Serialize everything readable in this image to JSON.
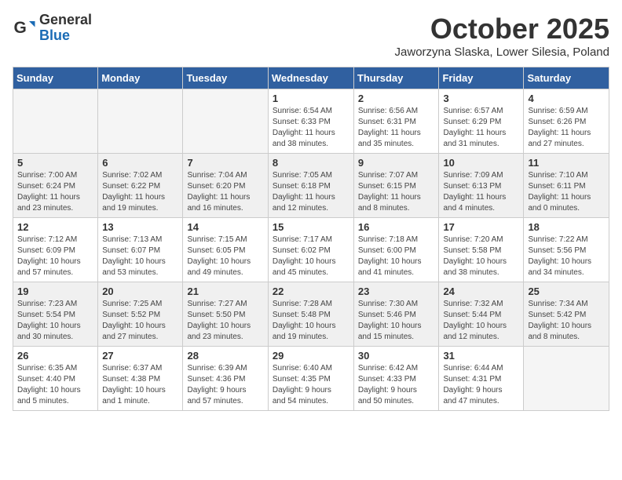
{
  "header": {
    "logo": {
      "general": "General",
      "blue": "Blue"
    },
    "title": "October 2025",
    "subtitle": "Jaworzyna Slaska, Lower Silesia, Poland"
  },
  "weekdays": [
    "Sunday",
    "Monday",
    "Tuesday",
    "Wednesday",
    "Thursday",
    "Friday",
    "Saturday"
  ],
  "weeks": [
    [
      {
        "day": "",
        "info": ""
      },
      {
        "day": "",
        "info": ""
      },
      {
        "day": "",
        "info": ""
      },
      {
        "day": "1",
        "info": "Sunrise: 6:54 AM\nSunset: 6:33 PM\nDaylight: 11 hours\nand 38 minutes."
      },
      {
        "day": "2",
        "info": "Sunrise: 6:56 AM\nSunset: 6:31 PM\nDaylight: 11 hours\nand 35 minutes."
      },
      {
        "day": "3",
        "info": "Sunrise: 6:57 AM\nSunset: 6:29 PM\nDaylight: 11 hours\nand 31 minutes."
      },
      {
        "day": "4",
        "info": "Sunrise: 6:59 AM\nSunset: 6:26 PM\nDaylight: 11 hours\nand 27 minutes."
      }
    ],
    [
      {
        "day": "5",
        "info": "Sunrise: 7:00 AM\nSunset: 6:24 PM\nDaylight: 11 hours\nand 23 minutes."
      },
      {
        "day": "6",
        "info": "Sunrise: 7:02 AM\nSunset: 6:22 PM\nDaylight: 11 hours\nand 19 minutes."
      },
      {
        "day": "7",
        "info": "Sunrise: 7:04 AM\nSunset: 6:20 PM\nDaylight: 11 hours\nand 16 minutes."
      },
      {
        "day": "8",
        "info": "Sunrise: 7:05 AM\nSunset: 6:18 PM\nDaylight: 11 hours\nand 12 minutes."
      },
      {
        "day": "9",
        "info": "Sunrise: 7:07 AM\nSunset: 6:15 PM\nDaylight: 11 hours\nand 8 minutes."
      },
      {
        "day": "10",
        "info": "Sunrise: 7:09 AM\nSunset: 6:13 PM\nDaylight: 11 hours\nand 4 minutes."
      },
      {
        "day": "11",
        "info": "Sunrise: 7:10 AM\nSunset: 6:11 PM\nDaylight: 11 hours\nand 0 minutes."
      }
    ],
    [
      {
        "day": "12",
        "info": "Sunrise: 7:12 AM\nSunset: 6:09 PM\nDaylight: 10 hours\nand 57 minutes."
      },
      {
        "day": "13",
        "info": "Sunrise: 7:13 AM\nSunset: 6:07 PM\nDaylight: 10 hours\nand 53 minutes."
      },
      {
        "day": "14",
        "info": "Sunrise: 7:15 AM\nSunset: 6:05 PM\nDaylight: 10 hours\nand 49 minutes."
      },
      {
        "day": "15",
        "info": "Sunrise: 7:17 AM\nSunset: 6:02 PM\nDaylight: 10 hours\nand 45 minutes."
      },
      {
        "day": "16",
        "info": "Sunrise: 7:18 AM\nSunset: 6:00 PM\nDaylight: 10 hours\nand 41 minutes."
      },
      {
        "day": "17",
        "info": "Sunrise: 7:20 AM\nSunset: 5:58 PM\nDaylight: 10 hours\nand 38 minutes."
      },
      {
        "day": "18",
        "info": "Sunrise: 7:22 AM\nSunset: 5:56 PM\nDaylight: 10 hours\nand 34 minutes."
      }
    ],
    [
      {
        "day": "19",
        "info": "Sunrise: 7:23 AM\nSunset: 5:54 PM\nDaylight: 10 hours\nand 30 minutes."
      },
      {
        "day": "20",
        "info": "Sunrise: 7:25 AM\nSunset: 5:52 PM\nDaylight: 10 hours\nand 27 minutes."
      },
      {
        "day": "21",
        "info": "Sunrise: 7:27 AM\nSunset: 5:50 PM\nDaylight: 10 hours\nand 23 minutes."
      },
      {
        "day": "22",
        "info": "Sunrise: 7:28 AM\nSunset: 5:48 PM\nDaylight: 10 hours\nand 19 minutes."
      },
      {
        "day": "23",
        "info": "Sunrise: 7:30 AM\nSunset: 5:46 PM\nDaylight: 10 hours\nand 15 minutes."
      },
      {
        "day": "24",
        "info": "Sunrise: 7:32 AM\nSunset: 5:44 PM\nDaylight: 10 hours\nand 12 minutes."
      },
      {
        "day": "25",
        "info": "Sunrise: 7:34 AM\nSunset: 5:42 PM\nDaylight: 10 hours\nand 8 minutes."
      }
    ],
    [
      {
        "day": "26",
        "info": "Sunrise: 6:35 AM\nSunset: 4:40 PM\nDaylight: 10 hours\nand 5 minutes."
      },
      {
        "day": "27",
        "info": "Sunrise: 6:37 AM\nSunset: 4:38 PM\nDaylight: 10 hours\nand 1 minute."
      },
      {
        "day": "28",
        "info": "Sunrise: 6:39 AM\nSunset: 4:36 PM\nDaylight: 9 hours\nand 57 minutes."
      },
      {
        "day": "29",
        "info": "Sunrise: 6:40 AM\nSunset: 4:35 PM\nDaylight: 9 hours\nand 54 minutes."
      },
      {
        "day": "30",
        "info": "Sunrise: 6:42 AM\nSunset: 4:33 PM\nDaylight: 9 hours\nand 50 minutes."
      },
      {
        "day": "31",
        "info": "Sunrise: 6:44 AM\nSunset: 4:31 PM\nDaylight: 9 hours\nand 47 minutes."
      },
      {
        "day": "",
        "info": ""
      }
    ]
  ]
}
